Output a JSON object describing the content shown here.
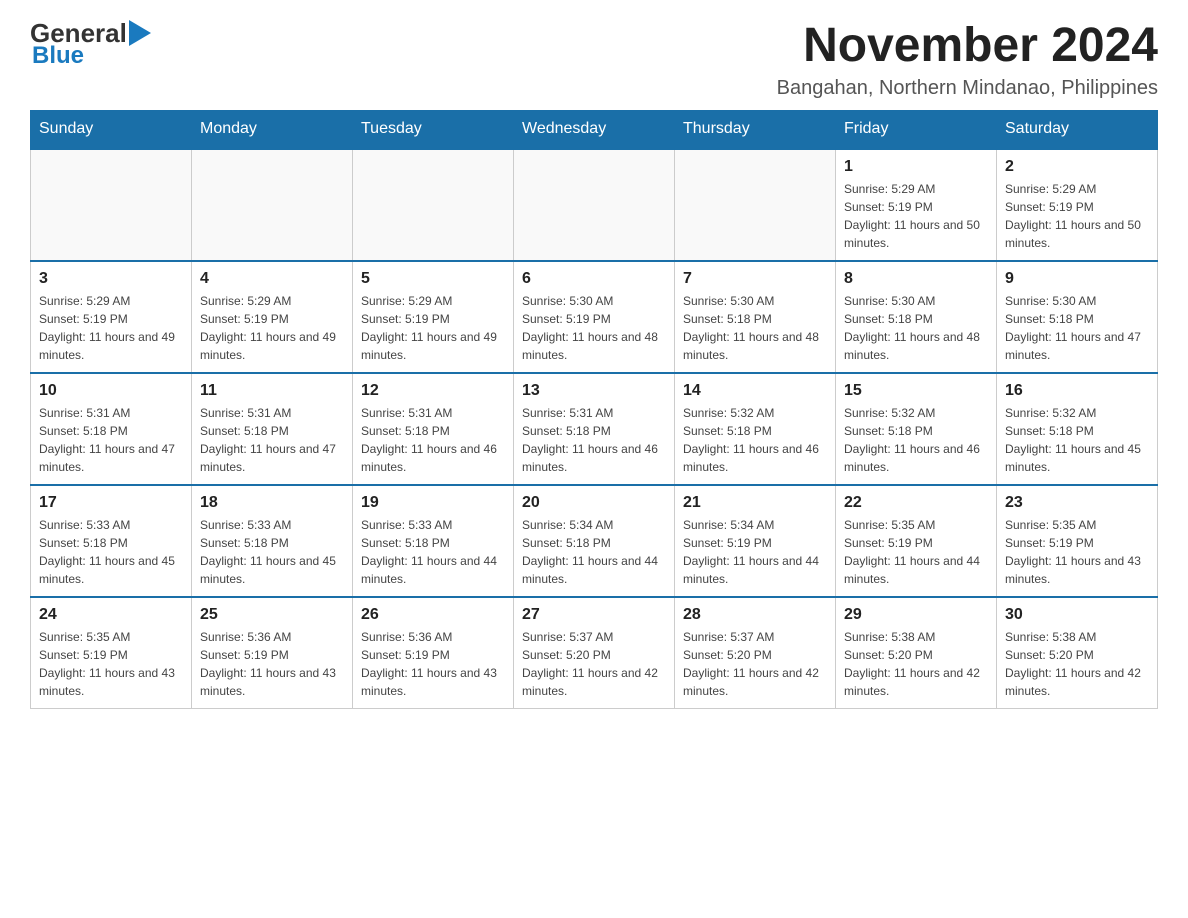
{
  "header": {
    "logo_general": "General",
    "logo_blue": "Blue",
    "month_year": "November 2024",
    "location": "Bangahan, Northern Mindanao, Philippines"
  },
  "days_of_week": [
    "Sunday",
    "Monday",
    "Tuesday",
    "Wednesday",
    "Thursday",
    "Friday",
    "Saturday"
  ],
  "weeks": [
    {
      "days": [
        {
          "number": "",
          "info": ""
        },
        {
          "number": "",
          "info": ""
        },
        {
          "number": "",
          "info": ""
        },
        {
          "number": "",
          "info": ""
        },
        {
          "number": "",
          "info": ""
        },
        {
          "number": "1",
          "info": "Sunrise: 5:29 AM\nSunset: 5:19 PM\nDaylight: 11 hours and 50 minutes."
        },
        {
          "number": "2",
          "info": "Sunrise: 5:29 AM\nSunset: 5:19 PM\nDaylight: 11 hours and 50 minutes."
        }
      ]
    },
    {
      "days": [
        {
          "number": "3",
          "info": "Sunrise: 5:29 AM\nSunset: 5:19 PM\nDaylight: 11 hours and 49 minutes."
        },
        {
          "number": "4",
          "info": "Sunrise: 5:29 AM\nSunset: 5:19 PM\nDaylight: 11 hours and 49 minutes."
        },
        {
          "number": "5",
          "info": "Sunrise: 5:29 AM\nSunset: 5:19 PM\nDaylight: 11 hours and 49 minutes."
        },
        {
          "number": "6",
          "info": "Sunrise: 5:30 AM\nSunset: 5:19 PM\nDaylight: 11 hours and 48 minutes."
        },
        {
          "number": "7",
          "info": "Sunrise: 5:30 AM\nSunset: 5:18 PM\nDaylight: 11 hours and 48 minutes."
        },
        {
          "number": "8",
          "info": "Sunrise: 5:30 AM\nSunset: 5:18 PM\nDaylight: 11 hours and 48 minutes."
        },
        {
          "number": "9",
          "info": "Sunrise: 5:30 AM\nSunset: 5:18 PM\nDaylight: 11 hours and 47 minutes."
        }
      ]
    },
    {
      "days": [
        {
          "number": "10",
          "info": "Sunrise: 5:31 AM\nSunset: 5:18 PM\nDaylight: 11 hours and 47 minutes."
        },
        {
          "number": "11",
          "info": "Sunrise: 5:31 AM\nSunset: 5:18 PM\nDaylight: 11 hours and 47 minutes."
        },
        {
          "number": "12",
          "info": "Sunrise: 5:31 AM\nSunset: 5:18 PM\nDaylight: 11 hours and 46 minutes."
        },
        {
          "number": "13",
          "info": "Sunrise: 5:31 AM\nSunset: 5:18 PM\nDaylight: 11 hours and 46 minutes."
        },
        {
          "number": "14",
          "info": "Sunrise: 5:32 AM\nSunset: 5:18 PM\nDaylight: 11 hours and 46 minutes."
        },
        {
          "number": "15",
          "info": "Sunrise: 5:32 AM\nSunset: 5:18 PM\nDaylight: 11 hours and 46 minutes."
        },
        {
          "number": "16",
          "info": "Sunrise: 5:32 AM\nSunset: 5:18 PM\nDaylight: 11 hours and 45 minutes."
        }
      ]
    },
    {
      "days": [
        {
          "number": "17",
          "info": "Sunrise: 5:33 AM\nSunset: 5:18 PM\nDaylight: 11 hours and 45 minutes."
        },
        {
          "number": "18",
          "info": "Sunrise: 5:33 AM\nSunset: 5:18 PM\nDaylight: 11 hours and 45 minutes."
        },
        {
          "number": "19",
          "info": "Sunrise: 5:33 AM\nSunset: 5:18 PM\nDaylight: 11 hours and 44 minutes."
        },
        {
          "number": "20",
          "info": "Sunrise: 5:34 AM\nSunset: 5:18 PM\nDaylight: 11 hours and 44 minutes."
        },
        {
          "number": "21",
          "info": "Sunrise: 5:34 AM\nSunset: 5:19 PM\nDaylight: 11 hours and 44 minutes."
        },
        {
          "number": "22",
          "info": "Sunrise: 5:35 AM\nSunset: 5:19 PM\nDaylight: 11 hours and 44 minutes."
        },
        {
          "number": "23",
          "info": "Sunrise: 5:35 AM\nSunset: 5:19 PM\nDaylight: 11 hours and 43 minutes."
        }
      ]
    },
    {
      "days": [
        {
          "number": "24",
          "info": "Sunrise: 5:35 AM\nSunset: 5:19 PM\nDaylight: 11 hours and 43 minutes."
        },
        {
          "number": "25",
          "info": "Sunrise: 5:36 AM\nSunset: 5:19 PM\nDaylight: 11 hours and 43 minutes."
        },
        {
          "number": "26",
          "info": "Sunrise: 5:36 AM\nSunset: 5:19 PM\nDaylight: 11 hours and 43 minutes."
        },
        {
          "number": "27",
          "info": "Sunrise: 5:37 AM\nSunset: 5:20 PM\nDaylight: 11 hours and 42 minutes."
        },
        {
          "number": "28",
          "info": "Sunrise: 5:37 AM\nSunset: 5:20 PM\nDaylight: 11 hours and 42 minutes."
        },
        {
          "number": "29",
          "info": "Sunrise: 5:38 AM\nSunset: 5:20 PM\nDaylight: 11 hours and 42 minutes."
        },
        {
          "number": "30",
          "info": "Sunrise: 5:38 AM\nSunset: 5:20 PM\nDaylight: 11 hours and 42 minutes."
        }
      ]
    }
  ]
}
